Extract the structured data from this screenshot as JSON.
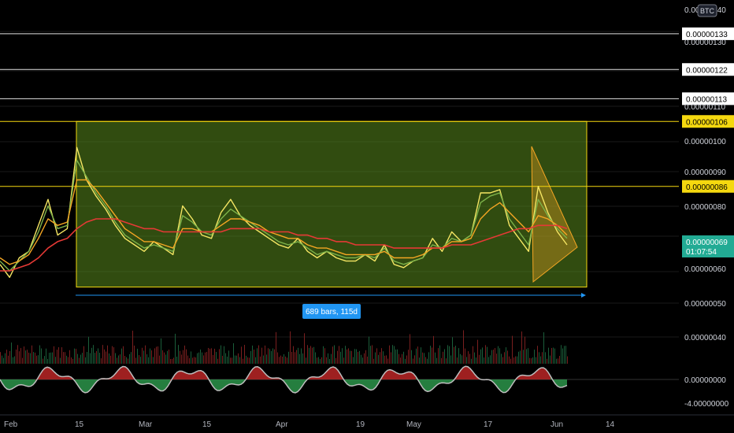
{
  "chart_data": {
    "type": "line",
    "currency_label": "BTC",
    "price_axis": {
      "ticks": [
        "0.00000140",
        "0.00000130",
        "0.00000120",
        "0.00000110",
        "0.00000100",
        "0.00000090",
        "0.00000080",
        "0.00000060",
        "0.00000050",
        "0.00000040"
      ],
      "range": [
        3.6e-07,
        1.43e-06
      ]
    },
    "oscillator_axis": {
      "ticks": [
        "0.00000000",
        "-4.00000000"
      ]
    },
    "date_axis": [
      "Feb",
      "15",
      "Mar",
      "15",
      "Apr",
      "19",
      "May",
      "17",
      "Jun",
      "14"
    ],
    "horizontal_lines": [
      {
        "label": "0.00000133",
        "value": 1.33e-06,
        "color": "#e0e0e0"
      },
      {
        "label": "0.00000122",
        "value": 1.22e-06,
        "color": "#e0e0e0"
      },
      {
        "label": "0.00000113",
        "value": 1.13e-06,
        "color": "#e0e0e0"
      },
      {
        "label": "0.00000106",
        "value": 1.06e-06,
        "color": "#f5d80f"
      },
      {
        "label": "0.00000086",
        "value": 8.6e-07,
        "color": "#f5d80f"
      }
    ],
    "current_price": {
      "label": "0.00000069",
      "countdown": "01:07:54",
      "color": "#22ab94"
    },
    "range_box": {
      "top": 1.06e-06,
      "bottom": 5.5e-07,
      "fill": "#5a8a1e",
      "stroke": "#f5d80f"
    },
    "measure_label": "689 bars, 115d",
    "series": [
      {
        "color": "#f5e663",
        "values": [
          6.2e-07,
          5.8e-07,
          6.4e-07,
          6.6e-07,
          7.4e-07,
          8.2e-07,
          7.1e-07,
          7.3e-07,
          9.8e-07,
          8.8e-07,
          8.3e-07,
          7.9e-07,
          7.4e-07,
          7e-07,
          6.8e-07,
          6.6e-07,
          6.9e-07,
          6.7e-07,
          6.5e-07,
          8e-07,
          7.6e-07,
          7.1e-07,
          7e-07,
          7.8e-07,
          8.2e-07,
          7.7e-07,
          7.4e-07,
          7.2e-07,
          7e-07,
          6.8e-07,
          6.7e-07,
          7e-07,
          6.6e-07,
          6.4e-07,
          6.6e-07,
          6.4e-07,
          6.3e-07,
          6.3e-07,
          6.5e-07,
          6.3e-07,
          6.8e-07,
          6.2e-07,
          6.1e-07,
          6.3e-07,
          6.4e-07,
          7e-07,
          6.6e-07,
          7.2e-07,
          6.9e-07,
          7.1e-07,
          8.4e-07,
          8.4e-07,
          8.5e-07,
          7.4e-07,
          7e-07,
          6.6e-07,
          8.6e-07,
          7.8e-07,
          7.2e-07,
          6.8e-07
        ]
      },
      {
        "color": "#7db34a",
        "values": [
          6.3e-07,
          6e-07,
          6.3e-07,
          6.6e-07,
          7.2e-07,
          8e-07,
          7.3e-07,
          7.4e-07,
          9.4e-07,
          8.9e-07,
          8.4e-07,
          8e-07,
          7.5e-07,
          7.1e-07,
          6.9e-07,
          6.7e-07,
          6.8e-07,
          6.7e-07,
          6.6e-07,
          7.7e-07,
          7.5e-07,
          7.2e-07,
          7.1e-07,
          7.6e-07,
          7.9e-07,
          7.7e-07,
          7.5e-07,
          7.3e-07,
          7.1e-07,
          6.9e-07,
          6.8e-07,
          6.9e-07,
          6.7e-07,
          6.5e-07,
          6.6e-07,
          6.5e-07,
          6.4e-07,
          6.4e-07,
          6.5e-07,
          6.4e-07,
          6.7e-07,
          6.3e-07,
          6.2e-07,
          6.3e-07,
          6.4e-07,
          6.8e-07,
          6.7e-07,
          7e-07,
          6.9e-07,
          7.1e-07,
          8.1e-07,
          8.3e-07,
          8.4e-07,
          7.6e-07,
          7.2e-07,
          6.8e-07,
          8.2e-07,
          7.7e-07,
          7.3e-07,
          7e-07
        ]
      },
      {
        "color": "#f5a623",
        "values": [
          6.4e-07,
          6.2e-07,
          6.3e-07,
          6.5e-07,
          7e-07,
          7.6e-07,
          7.4e-07,
          7.5e-07,
          8.8e-07,
          8.8e-07,
          8.5e-07,
          8.1e-07,
          7.7e-07,
          7.3e-07,
          7.1e-07,
          6.9e-07,
          6.9e-07,
          6.8e-07,
          6.7e-07,
          7.3e-07,
          7.3e-07,
          7.2e-07,
          7.2e-07,
          7.4e-07,
          7.6e-07,
          7.6e-07,
          7.5e-07,
          7.4e-07,
          7.2e-07,
          7.1e-07,
          7e-07,
          7e-07,
          6.8e-07,
          6.7e-07,
          6.7e-07,
          6.6e-07,
          6.5e-07,
          6.5e-07,
          6.5e-07,
          6.5e-07,
          6.6e-07,
          6.4e-07,
          6.4e-07,
          6.4e-07,
          6.5e-07,
          6.7e-07,
          6.7e-07,
          6.9e-07,
          6.9e-07,
          7e-07,
          7.6e-07,
          7.9e-07,
          8.1e-07,
          7.8e-07,
          7.5e-07,
          7.2e-07,
          7.7e-07,
          7.6e-07,
          7.4e-07,
          7.1e-07
        ]
      },
      {
        "color": "#e53935",
        "values": [
          6e-07,
          6e-07,
          6.1e-07,
          6.2e-07,
          6.4e-07,
          6.7e-07,
          6.9e-07,
          7e-07,
          7.3e-07,
          7.5e-07,
          7.6e-07,
          7.6e-07,
          7.6e-07,
          7.5e-07,
          7.4e-07,
          7.3e-07,
          7.3e-07,
          7.2e-07,
          7.2e-07,
          7.2e-07,
          7.2e-07,
          7.2e-07,
          7.2e-07,
          7.2e-07,
          7.3e-07,
          7.3e-07,
          7.3e-07,
          7.3e-07,
          7.2e-07,
          7.2e-07,
          7.2e-07,
          7.1e-07,
          7.1e-07,
          7e-07,
          7e-07,
          6.9e-07,
          6.9e-07,
          6.8e-07,
          6.8e-07,
          6.8e-07,
          6.8e-07,
          6.7e-07,
          6.7e-07,
          6.7e-07,
          6.7e-07,
          6.7e-07,
          6.7e-07,
          6.8e-07,
          6.8e-07,
          6.8e-07,
          6.9e-07,
          7e-07,
          7.1e-07,
          7.2e-07,
          7.3e-07,
          7.3e-07,
          7.4e-07,
          7.4e-07,
          7.4e-07,
          7.3e-07
        ]
      }
    ]
  }
}
